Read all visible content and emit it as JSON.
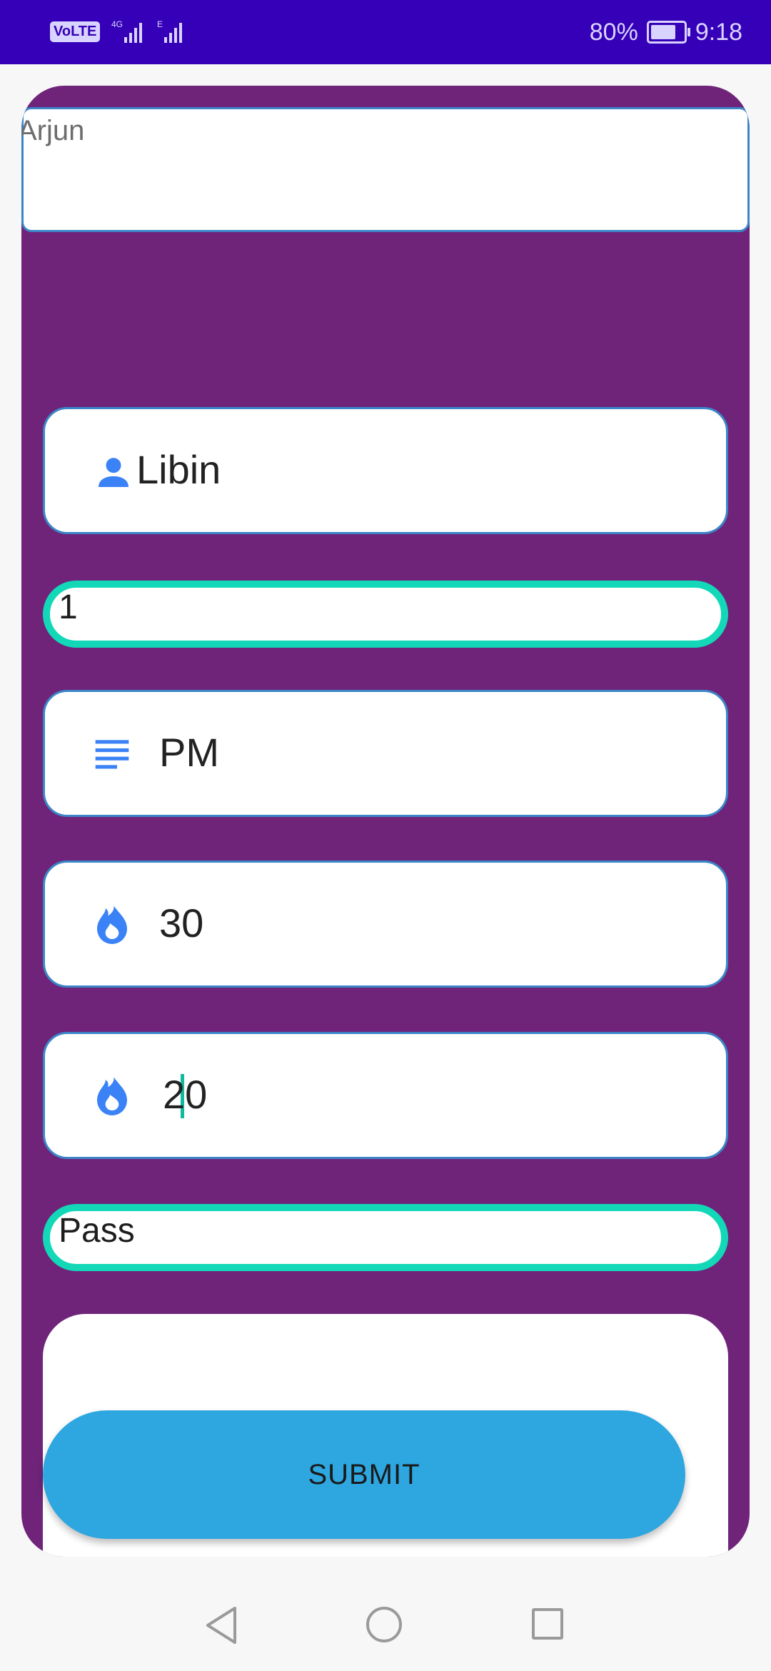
{
  "status_bar": {
    "volte": "VoLTE",
    "network_4g": "4G",
    "network_e": "E",
    "battery_percent": "80%",
    "time": "9:18"
  },
  "form": {
    "top_field_value": "Arjun",
    "name_value": "Libin",
    "number_value": "1",
    "period_value": "PM",
    "value_a": "30",
    "value_b": "20",
    "password_value": "Pass",
    "submit_label": "SUBMIT"
  },
  "icons": {
    "name": "person-icon",
    "period": "subject-lines-icon",
    "value_a": "fire-icon",
    "value_b": "fire-icon"
  },
  "colors": {
    "status_bar": "#3500b8",
    "card": "#6f247a",
    "focus_border": "#12d8b8",
    "icon": "#3b82f6",
    "submit": "#2ea6e0"
  }
}
